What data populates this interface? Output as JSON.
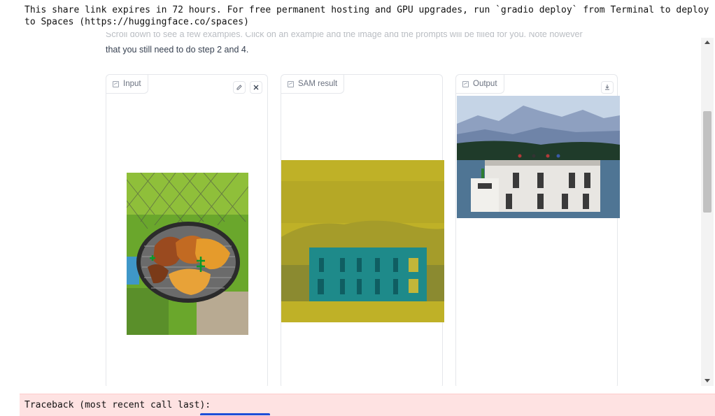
{
  "banner": {
    "message": "This share link expires in 72 hours. For free permanent hosting and GPU upgrades, run `gradio deploy` from Terminal to deploy to Spaces (https://huggingface.co/spaces)"
  },
  "intro": {
    "cut_line": "Scroll down to see a few examples. Click on an example and the image and the prompts will be filled for you. Note however",
    "visible_line": "that you still need to do step 2 and 4."
  },
  "panels": {
    "input": {
      "label": "Input",
      "edit_icon": "pencil-icon",
      "clear_icon": "close-icon"
    },
    "sam": {
      "label": "SAM result"
    },
    "output": {
      "label": "Output",
      "download_icon": "download-icon"
    }
  },
  "error": {
    "text": "Traceback (most recent call last):"
  },
  "colors": {
    "error_bg": "#fee2e2",
    "mask_yellow": "#bfb127",
    "mask_teal": "#1e8a8a"
  }
}
